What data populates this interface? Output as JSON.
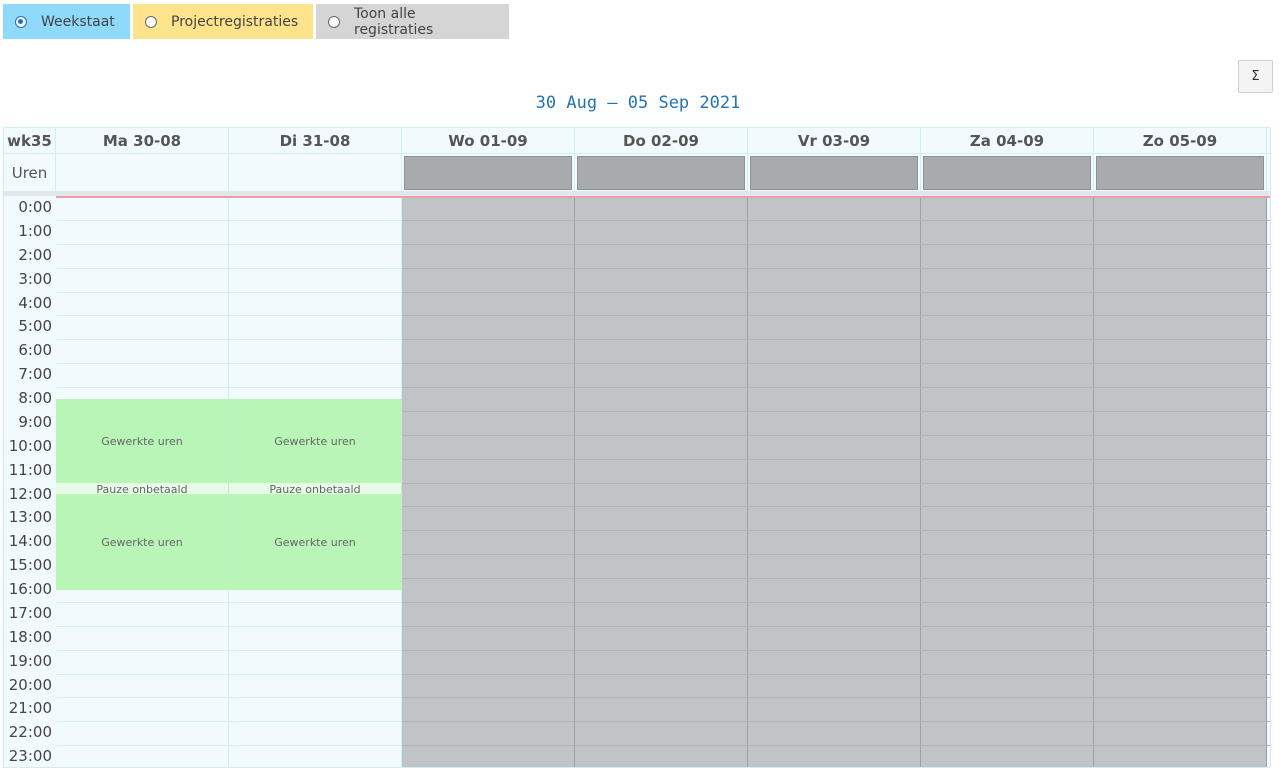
{
  "modes": [
    {
      "label": "Weekstaat",
      "selected": true
    },
    {
      "label": "Projectregistraties",
      "selected": false
    },
    {
      "label": "Toon alle registraties",
      "selected": false
    }
  ],
  "sum_button": "Σ",
  "date_range": "30 Aug – 05 Sep 2021",
  "calendar": {
    "week_label": "wk35",
    "uren_label": "Uren",
    "days": [
      "Ma 30-08",
      "Di 31-08",
      "Wo 01-09",
      "Do 02-09",
      "Vr 03-09",
      "Za 04-09",
      "Zo 05-09"
    ],
    "hours": [
      "0:00",
      "1:00",
      "2:00",
      "3:00",
      "4:00",
      "5:00",
      "6:00",
      "7:00",
      "8:00",
      "9:00",
      "10:00",
      "11:00",
      "12:00",
      "13:00",
      "14:00",
      "15:00",
      "16:00",
      "17:00",
      "18:00",
      "19:00",
      "20:00",
      "21:00",
      "22:00",
      "23:00"
    ],
    "events": {
      "work_morning": "Gewerkte uren",
      "pause": "Pauze onbetaald",
      "work_afternoon": "Gewerkte uren"
    }
  },
  "colors": {
    "accent": "#2274b5",
    "weekstaat": "#8fd9fa",
    "projectregistraties": "#fde38b",
    "alle_registraties": "#d5d5d5",
    "worked": "#b9f5b7",
    "pause": "#e7f9e7",
    "unavailable": "#c0c4c7"
  }
}
